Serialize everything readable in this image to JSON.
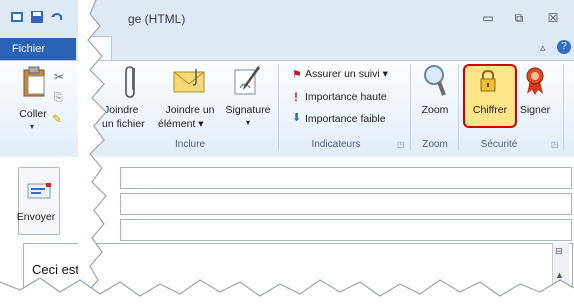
{
  "window": {
    "title": "ge (HTML)",
    "minimize": "▭",
    "restore": "⧉",
    "close": "☒",
    "caret_icon": "▵",
    "help_icon": "?"
  },
  "tabs": {
    "file": "Fichier"
  },
  "ribbon": {
    "clipboard": {
      "paste_label": "Coller"
    },
    "include": {
      "group_label": "Inclure",
      "attach_file_l1": "Joindre",
      "attach_file_l2": "un fichier",
      "attach_item_l1": "Joindre un",
      "attach_item_l2": "élément ▾",
      "signature_l1": "Signature",
      "signature_l2": "▾"
    },
    "tags": {
      "group_label": "Indicateurs",
      "follow_up": "Assurer un suivi ▾",
      "high_importance": "Importance haute",
      "low_importance": "Importance faible"
    },
    "zoom": {
      "group_label": "Zoom",
      "zoom_label": "Zoom"
    },
    "security": {
      "group_label": "Sécurité",
      "encrypt_label": "Chiffrer",
      "sign_label": "Signer"
    }
  },
  "compose": {
    "send_label": "Envoyer",
    "body_text": "Ceci est u"
  },
  "colors": {
    "highlight_border": "#d40000",
    "file_tab": "#2a63b5"
  }
}
